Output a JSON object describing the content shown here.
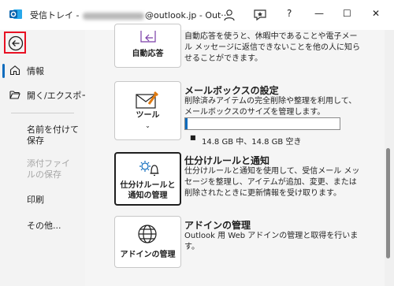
{
  "titlebar": {
    "title_prefix": "受信トレイ - ",
    "title_suffix": "@outlook.jp  -  Out···",
    "help_label": "?",
    "min_label": "—",
    "max_label": "☐",
    "close_label": "✕"
  },
  "sidebar": {
    "items": [
      {
        "label": "情報"
      },
      {
        "label": "開く/エクスポート"
      },
      {
        "label": "名前を付けて保存"
      },
      {
        "label": "添付ファイルの保存"
      },
      {
        "label": "印刷"
      },
      {
        "label": "その他..."
      }
    ]
  },
  "sections": {
    "auto_reply": {
      "button_label": "自動応答",
      "description": "自動応答を使うと、休暇中であることや電子メール メッセージに返信できないことを他の人に知らせることができます。"
    },
    "mailbox": {
      "title": "メールボックスの設定",
      "button_label": "ツール",
      "description": "削除済みアイテムの完全削除や整理を利用して、メールボックスのサイズを管理します。",
      "usage_text": "14.8 GB 中、14.8 GB 空き",
      "usage_fraction": 0.01
    },
    "rules": {
      "title": "仕分けルールと通知",
      "button_label": "仕分けルールと\n通知の管理",
      "description": "仕分けルールと通知を使用して、受信メール メッセージを整理し、アイテムが追加、変更、または削除されたときに更新情報を受け取ります。"
    },
    "addins": {
      "title": "アドインの管理",
      "button_label": "アドインの管理",
      "description": "Outlook 用 Web アドインの管理と取得を行います。"
    }
  },
  "colors": {
    "accent": "#0f6cbd",
    "highlight_border": "#e81123",
    "sidebar_bg": "#f3f3f3",
    "content_bg": "#f5f5f5"
  }
}
